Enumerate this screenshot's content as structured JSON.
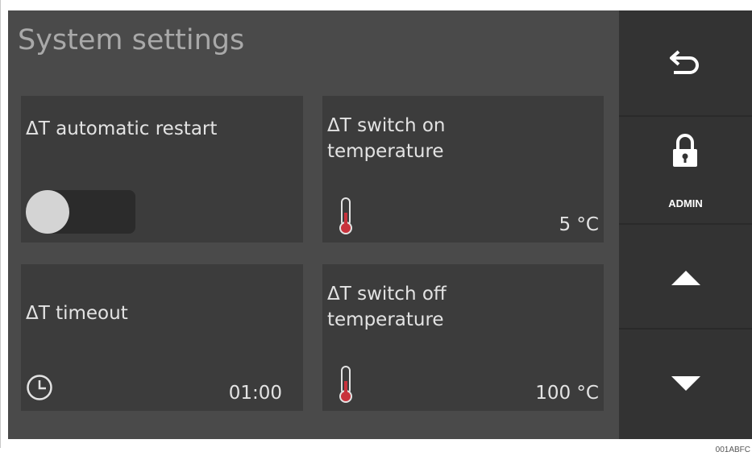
{
  "screen": {
    "title": "System settings"
  },
  "tiles": {
    "auto_restart": {
      "label": "ΔT automatic restart",
      "toggle_on": false
    },
    "switch_on": {
      "label": "ΔT switch on\ntemperature",
      "value": "5 °C",
      "icon": "thermometer-icon"
    },
    "timeout": {
      "label": "ΔT timeout",
      "value": "01:00",
      "icon": "clock-icon"
    },
    "switch_off": {
      "label": "ΔT switch off\ntemperature",
      "value": "100 °C",
      "icon": "thermometer-icon"
    }
  },
  "sidebar": {
    "back_icon": "back-arrow-icon",
    "lock_icon": "padlock-icon",
    "admin_label": "ADMIN",
    "up_icon": "triangle-up-icon",
    "down_icon": "triangle-down-icon"
  },
  "reference_code": "001ABFC",
  "colors": {
    "screen_bg": "#4a4a4a",
    "tile_bg": "#3c3c3c",
    "sidebar_bg": "#333333",
    "thermometer_red": "#c8323c",
    "text": "#e3e3e3"
  }
}
